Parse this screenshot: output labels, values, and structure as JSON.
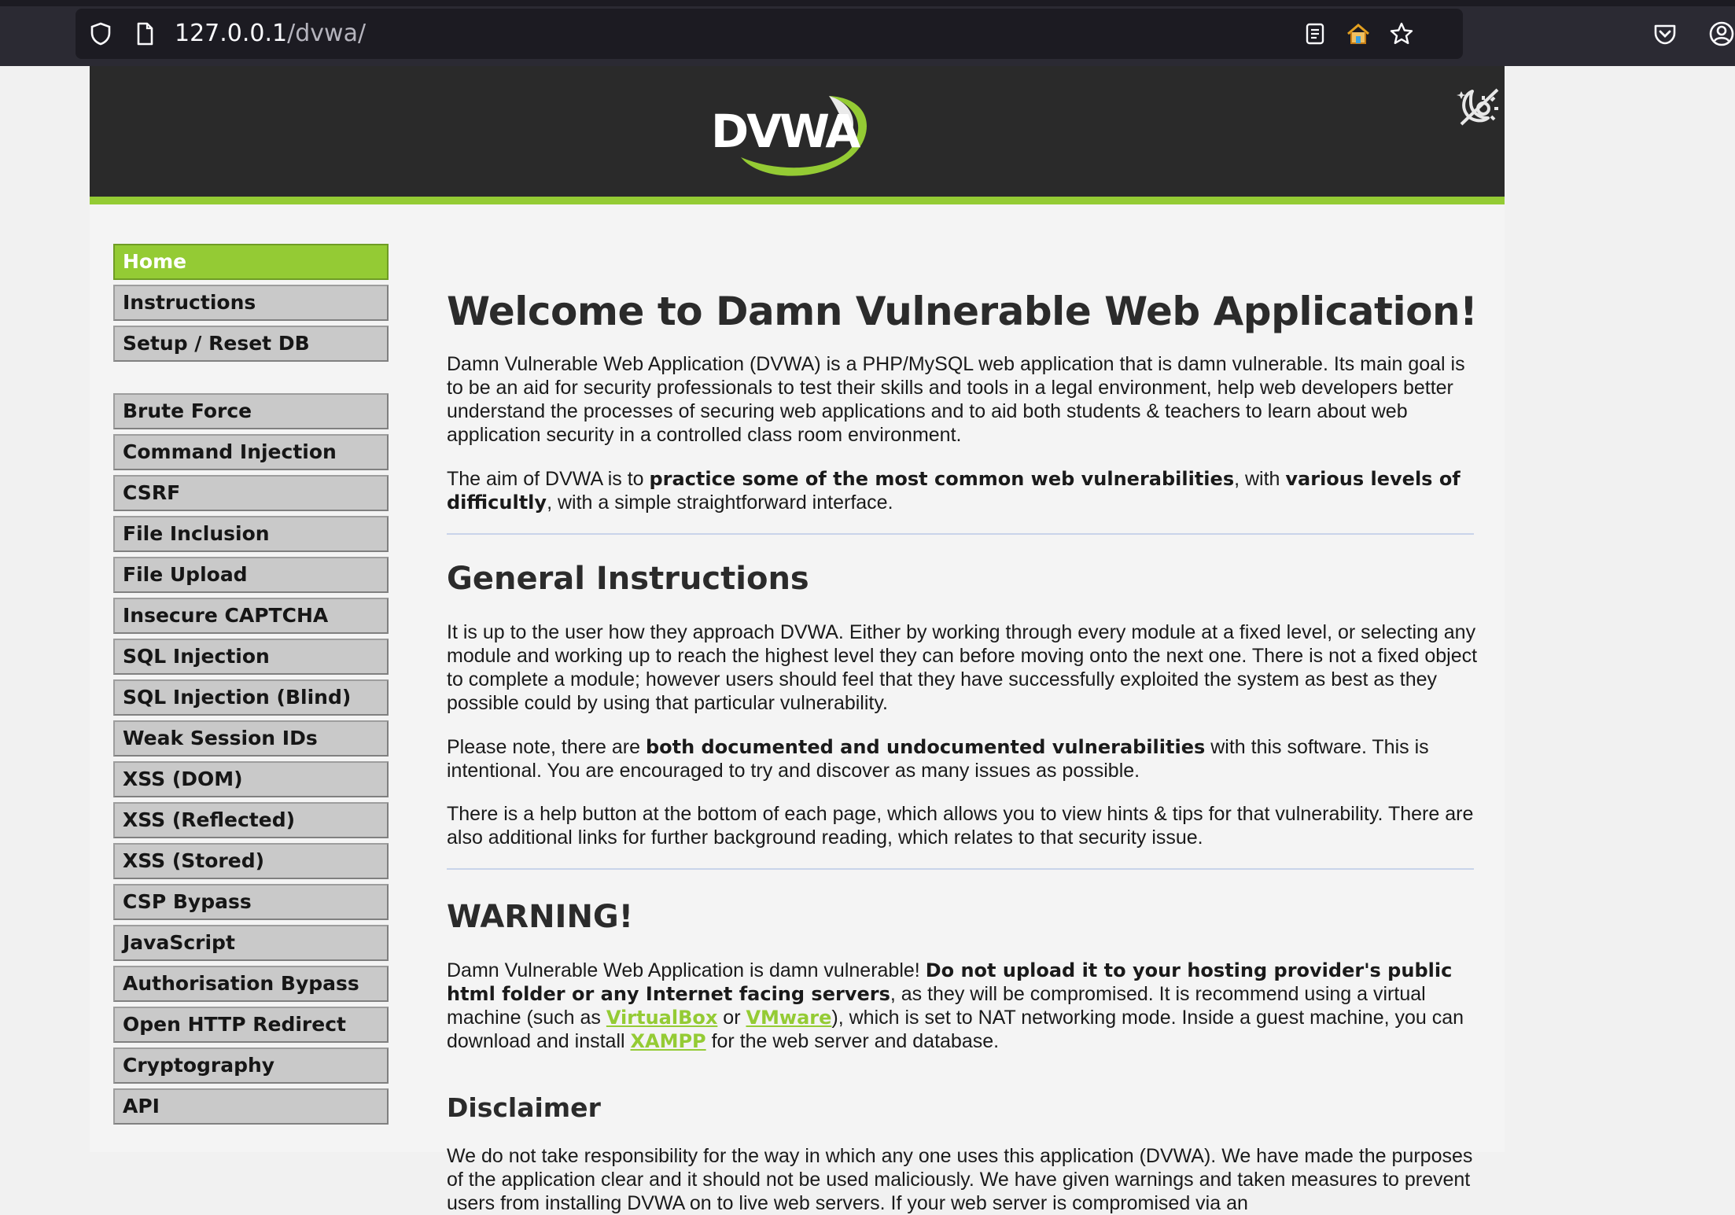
{
  "browser": {
    "url_host": "127.0.0.1",
    "url_path": "/dvwa/",
    "icons": [
      "shield-icon",
      "page-icon",
      "reader-view-icon",
      "home-icon",
      "bookmark-star-icon",
      "pocket-icon",
      "account-icon"
    ]
  },
  "header": {
    "logo_text": "DVWA",
    "theme_toggle_icon": "theme-toggle-icon"
  },
  "menu": {
    "items": [
      {
        "label": "Home",
        "active": true
      },
      {
        "label": "Instructions"
      },
      {
        "label": "Setup / Reset DB"
      },
      {
        "label": "Brute Force"
      },
      {
        "label": "Command Injection"
      },
      {
        "label": "CSRF"
      },
      {
        "label": "File Inclusion"
      },
      {
        "label": "File Upload"
      },
      {
        "label": "Insecure CAPTCHA"
      },
      {
        "label": "SQL Injection"
      },
      {
        "label": "SQL Injection (Blind)"
      },
      {
        "label": "Weak Session IDs"
      },
      {
        "label": "XSS (DOM)"
      },
      {
        "label": "XSS (Reflected)"
      },
      {
        "label": "XSS (Stored)"
      },
      {
        "label": "CSP Bypass"
      },
      {
        "label": "JavaScript"
      },
      {
        "label": "Authorisation Bypass"
      },
      {
        "label": "Open HTTP Redirect"
      },
      {
        "label": "Cryptography"
      },
      {
        "label": "API"
      }
    ]
  },
  "content": {
    "title": "Welcome to Damn Vulnerable Web Application!",
    "intro": "Damn Vulnerable Web Application (DVWA) is a PHP/MySQL web application that is damn vulnerable. Its main goal is to be an aid for security professionals to test their skills and tools in a legal environment, help web developers better understand the processes of securing web applications and to aid both students & teachers to learn about web application security in a controlled class room environment.",
    "aim": {
      "t1": "The aim of DVWA is to ",
      "b1": "practice some of the most common web vulnerabilities",
      "t2": ", with ",
      "b2": "various levels of difficultly",
      "t3": ", with a simple straightforward interface."
    },
    "general_heading": "General Instructions",
    "general_p1": "It is up to the user how they approach DVWA. Either by working through every module at a fixed level, or selecting any module and working up to reach the highest level they can before moving onto the next one. There is not a fixed object to complete a module; however users should feel that they have successfully exploited the system as best as they possible could by using that particular vulnerability.",
    "general_p2": {
      "t1": "Please note, there are ",
      "b1": "both documented and undocumented vulnerabilities",
      "t2": " with this software. This is intentional. You are encouraged to try and discover as many issues as possible."
    },
    "general_p3": "There is a help button at the bottom of each page, which allows you to view hints & tips for that vulnerability. There are also additional links for further background reading, which relates to that security issue.",
    "warning_heading": "WARNING!",
    "warning": {
      "t1": "Damn Vulnerable Web Application is damn vulnerable! ",
      "b1": "Do not upload it to your hosting provider's public html folder or any Internet facing servers",
      "t2": ", as they will be compromised. It is recommend using a virtual machine (such as ",
      "link1": "VirtualBox",
      "t3": " or ",
      "link2": "VMware",
      "t4": "), which is set to NAT networking mode. Inside a guest machine, you can download and install ",
      "link3": "XAMPP",
      "t5": " for the web server and database."
    },
    "disclaimer_heading": "Disclaimer",
    "disclaimer": "We do not take responsibility for the way in which any one uses this application (DVWA). We have made the purposes of the application clear and it should not be used maliciously. We have given warnings and taken measures to prevent users from installing DVWA on to live web servers. If your web server is compromised via an"
  },
  "colors": {
    "accent_green": "#94cb34",
    "header_dark": "#2a2a2a",
    "menu_grey": "#c9c9c9"
  }
}
